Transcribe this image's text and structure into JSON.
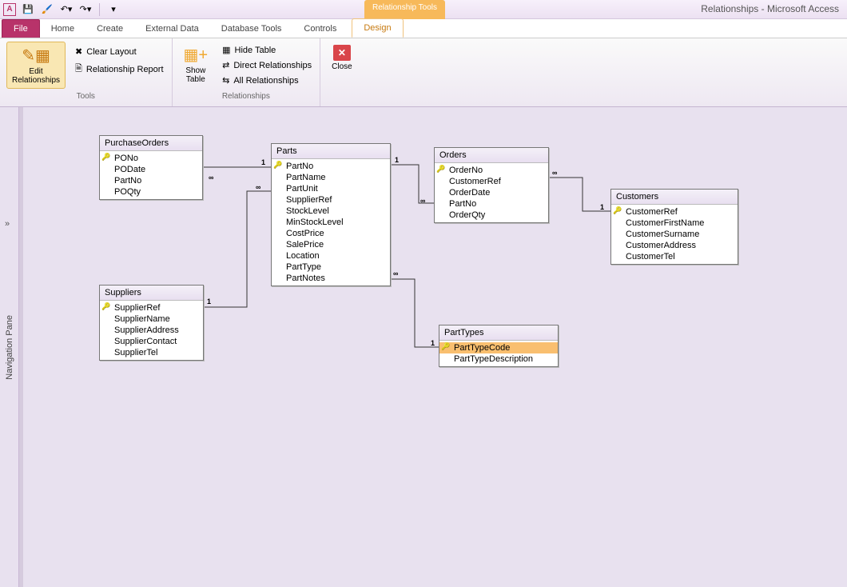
{
  "window_title": "Relationships - Microsoft Access",
  "contextual_tab": "Relationship Tools",
  "tabs": {
    "file": "File",
    "home": "Home",
    "create": "Create",
    "external": "External Data",
    "dbtools": "Database Tools",
    "controls": "Controls",
    "design": "Design"
  },
  "ribbon": {
    "edit_rel": "Edit\nRelationships",
    "clear_layout": "Clear Layout",
    "rel_report": "Relationship Report",
    "tools_label": "Tools",
    "show_table": "Show\nTable",
    "hide_table": "Hide Table",
    "direct_rel": "Direct Relationships",
    "all_rel": "All Relationships",
    "rel_label": "Relationships",
    "close": "Close"
  },
  "nav": {
    "label": "Navigation Pane",
    "chev": "»"
  },
  "tables": {
    "purchase_orders": {
      "title": "PurchaseOrders",
      "fields": [
        "PONo",
        "PODate",
        "PartNo",
        "POQty"
      ],
      "pk": [
        0
      ]
    },
    "parts": {
      "title": "Parts",
      "fields": [
        "PartNo",
        "PartName",
        "PartUnit",
        "SupplierRef",
        "StockLevel",
        "MinStockLevel",
        "CostPrice",
        "SalePrice",
        "Location",
        "PartType",
        "PartNotes"
      ],
      "pk": [
        0
      ]
    },
    "orders": {
      "title": "Orders",
      "fields": [
        "OrderNo",
        "CustomerRef",
        "OrderDate",
        "PartNo",
        "OrderQty"
      ],
      "pk": [
        0
      ]
    },
    "customers": {
      "title": "Customers",
      "fields": [
        "CustomerRef",
        "CustomerFirstName",
        "CustomerSurname",
        "CustomerAddress",
        "CustomerTel"
      ],
      "pk": [
        0
      ]
    },
    "suppliers": {
      "title": "Suppliers",
      "fields": [
        "SupplierRef",
        "SupplierName",
        "SupplierAddress",
        "SupplierContact",
        "SupplierTel"
      ],
      "pk": [
        0
      ]
    },
    "parttypes": {
      "title": "PartTypes",
      "fields": [
        "PartTypeCode",
        "PartTypeDescription"
      ],
      "pk": [
        0
      ],
      "selected_field": 0
    }
  },
  "rels": {
    "one": "1",
    "many": "∞"
  }
}
